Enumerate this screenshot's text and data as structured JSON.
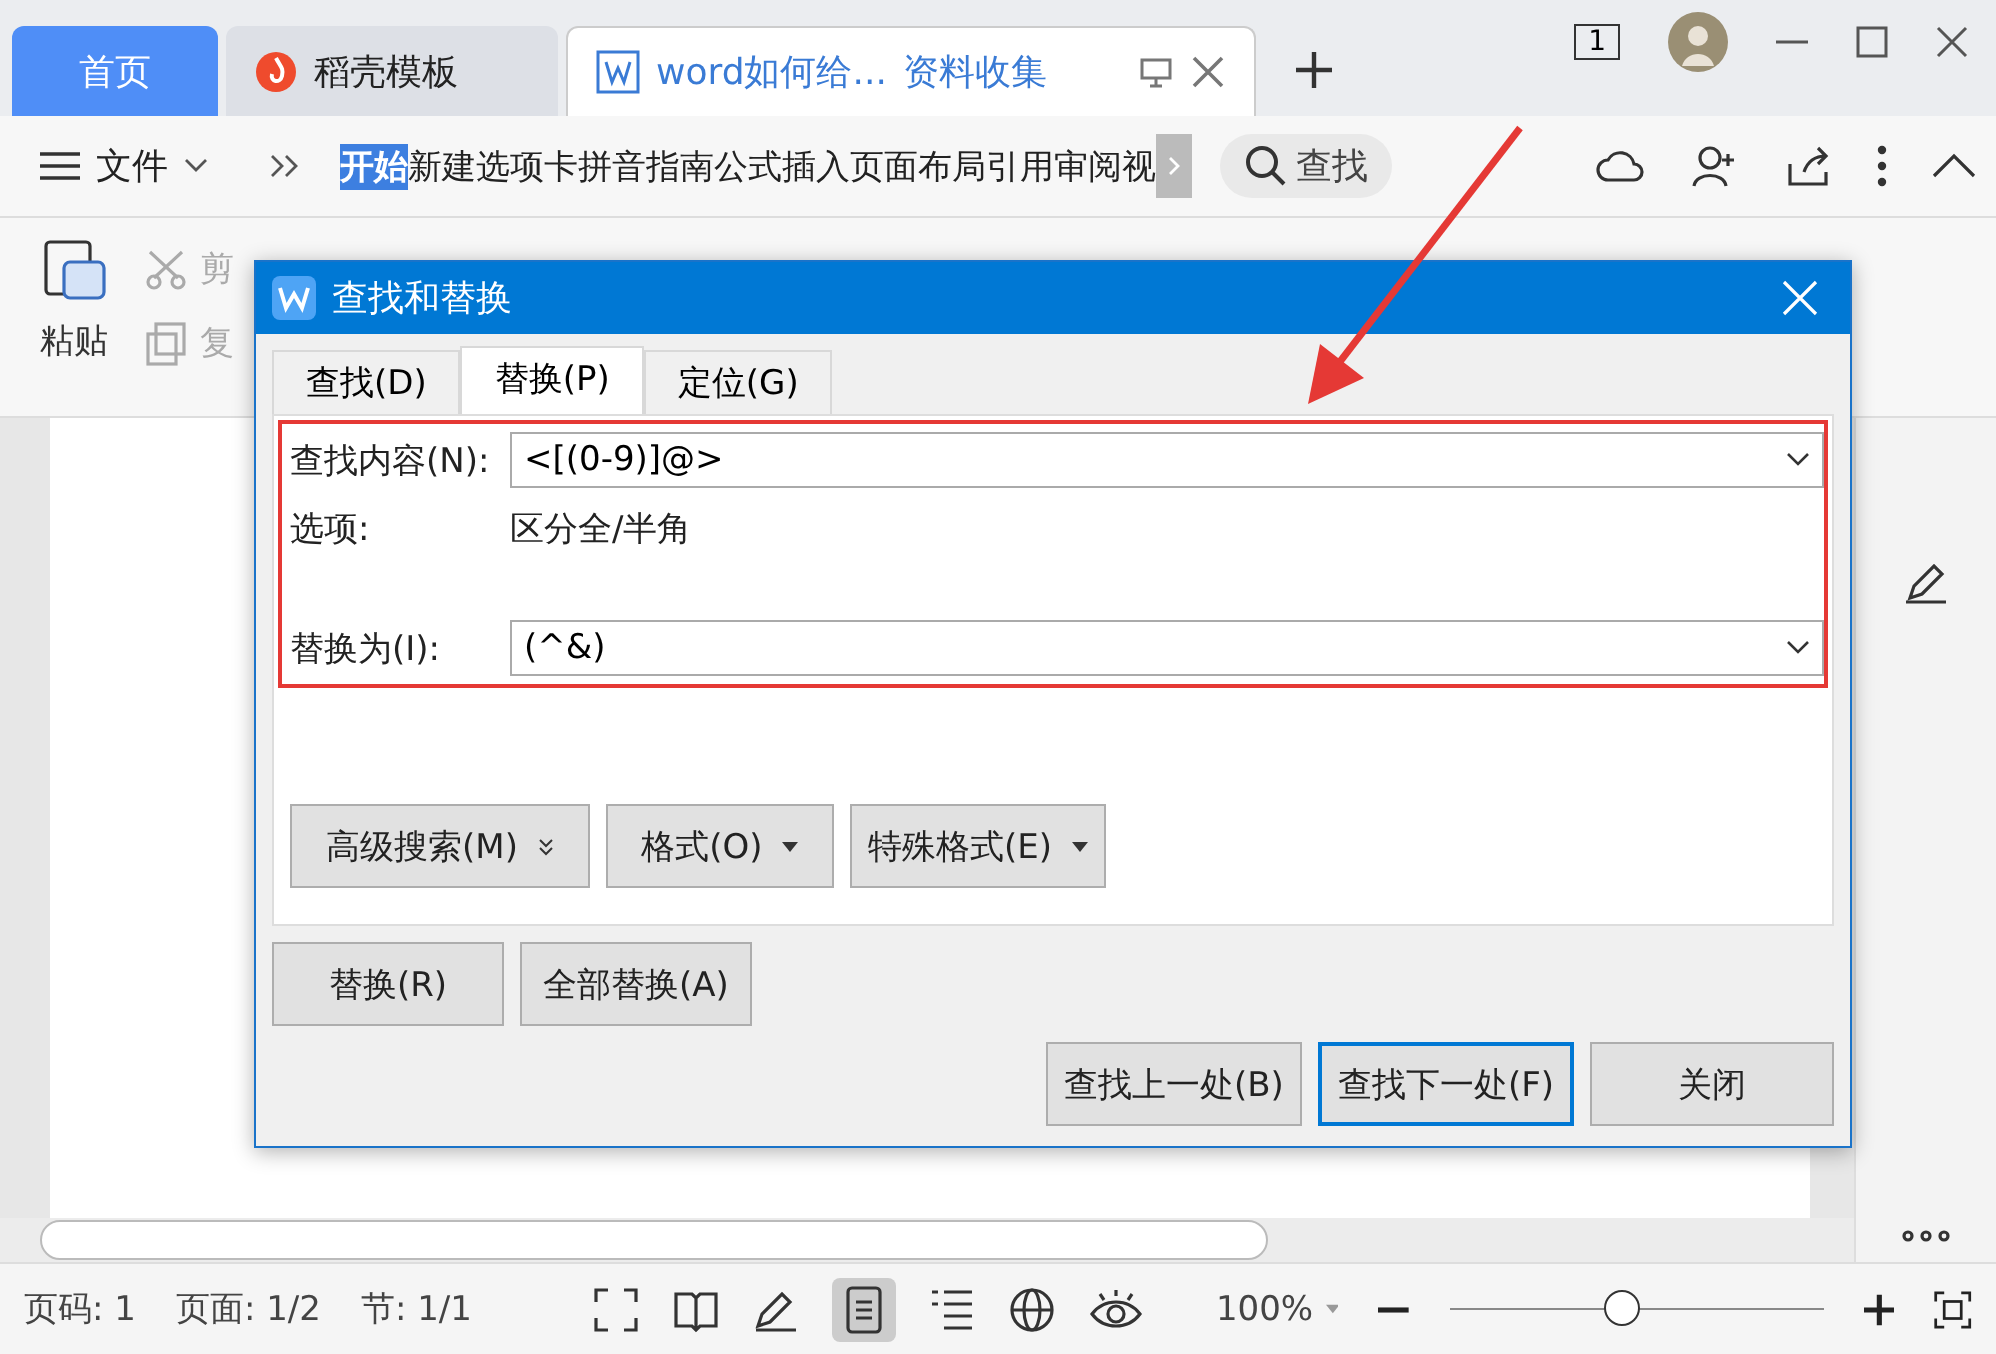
{
  "tabs": [
    {
      "label": "首页",
      "kind": "home",
      "selected": false
    },
    {
      "label": "稻壳模板",
      "kind": "docer",
      "selected": false
    },
    {
      "label": "word如何给...",
      "extra": "资料收集",
      "kind": "doc",
      "selected": true
    }
  ],
  "window_count": "1",
  "menu": {
    "file": "文件",
    "items": [
      {
        "label": "开始",
        "selected": true
      },
      {
        "label": "新建选项卡",
        "selected": false
      },
      {
        "label": "拼音指南",
        "selected": false
      },
      {
        "label": "公式",
        "selected": false
      },
      {
        "label": "插入",
        "selected": false
      },
      {
        "label": "页面布局",
        "selected": false
      },
      {
        "label": "引用",
        "selected": false
      },
      {
        "label": "审阅",
        "selected": false
      },
      {
        "label": "视",
        "selected": false
      }
    ],
    "search": "查找"
  },
  "ribbon": {
    "paste": "粘贴",
    "cut": "剪",
    "copy": "复"
  },
  "dialog": {
    "title": "查找和替换",
    "tabs": [
      {
        "label": "查找(D)",
        "selected": false
      },
      {
        "label": "替换(P)",
        "selected": true
      },
      {
        "label": "定位(G)",
        "selected": false
      }
    ],
    "find_label": "查找内容(N):",
    "find_value": "<[(0-9)]@>",
    "options_label": "选项:",
    "options_value": "区分全/半角",
    "replace_label": "替换为(I):",
    "replace_value": "(^&)",
    "option_buttons": [
      {
        "label": "高级搜索(M)",
        "kind": "double"
      },
      {
        "label": "格式(O)",
        "kind": "menu"
      },
      {
        "label": "特殊格式(E)",
        "kind": "menu"
      }
    ],
    "replace_buttons": [
      "替换(R)",
      "全部替换(A)"
    ],
    "nav_buttons": [
      {
        "label": "查找上一处(B)",
        "selected": false
      },
      {
        "label": "查找下一处(F)",
        "selected": true
      },
      {
        "label": "关闭",
        "selected": false
      }
    ]
  },
  "status": {
    "page": "页码: 1",
    "pages": "页面: 1/2",
    "section": "节: 1/1",
    "zoom": "100%",
    "level": 0.46
  }
}
